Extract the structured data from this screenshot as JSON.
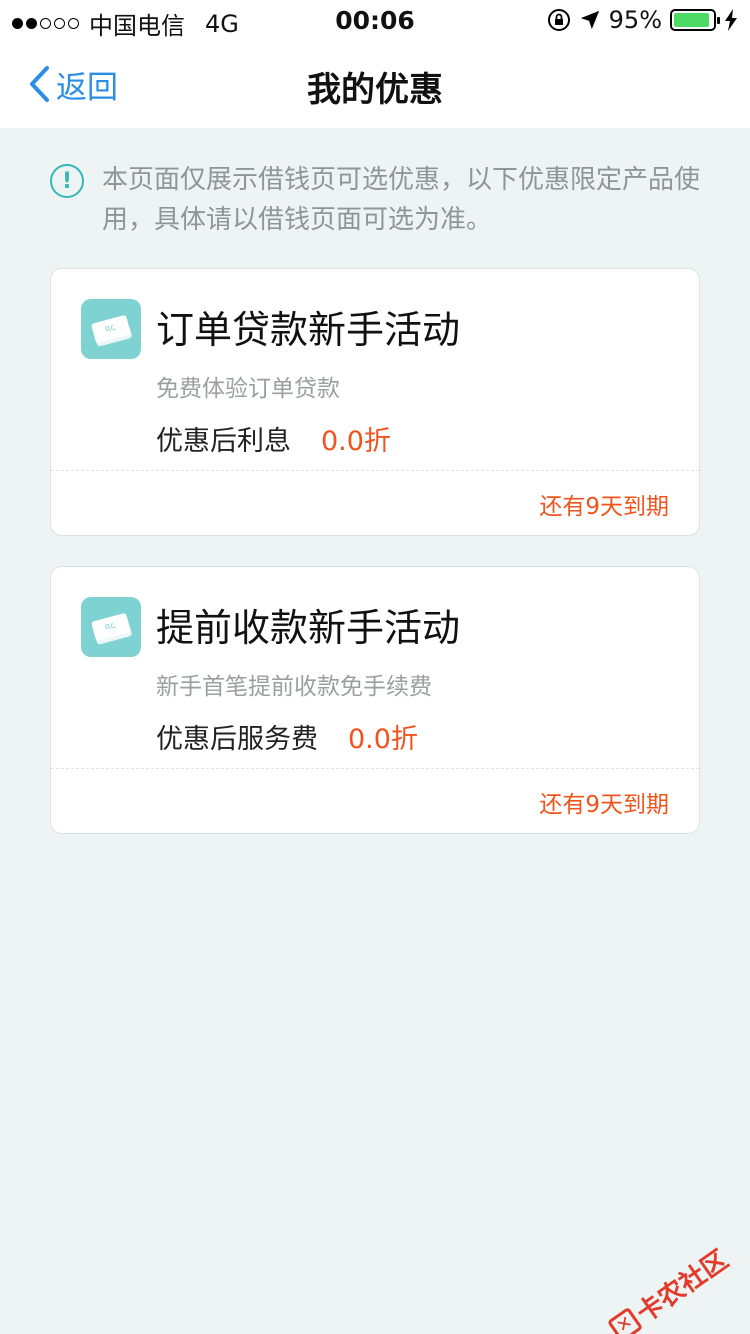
{
  "status_bar": {
    "carrier": "中国电信",
    "network": "4G",
    "time": "00:06",
    "battery": "95%",
    "battery_level": 0.95,
    "battery_color": "#4cd964"
  },
  "nav": {
    "back_label": "返回",
    "title": "我的优惠",
    "accent_color": "#2b8ee6"
  },
  "notice": {
    "icon": "info-circle-icon",
    "text": "本页面仅展示借钱页可选优惠，以下优惠限定产品使用，具体请以借钱页面可选为准。"
  },
  "coupons": [
    {
      "icon": "coupon-ticket-icon",
      "title": "订单贷款新手活动",
      "subtitle": "免费体验订单贷款",
      "benefit_label": "优惠后利息",
      "benefit_value": "0.0折",
      "expiry": "还有9天到期"
    },
    {
      "icon": "coupon-ticket-icon",
      "title": "提前收款新手活动",
      "subtitle": "新手首笔提前收款免手续费",
      "benefit_label": "优惠后服务费",
      "benefit_value": "0.0折",
      "expiry": "还有9天到期"
    }
  ],
  "watermark": {
    "text": "卡农社区"
  },
  "colors": {
    "background": "#eef4f4",
    "highlight": "#f0541c",
    "icon_bg": "#7fd2d2"
  }
}
